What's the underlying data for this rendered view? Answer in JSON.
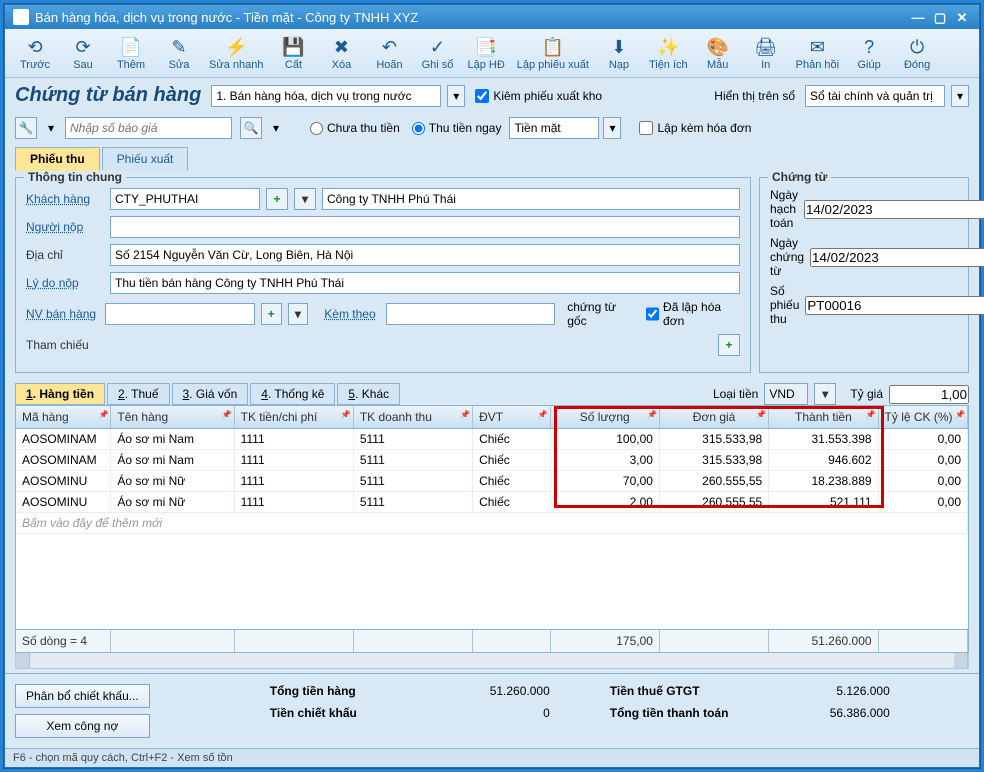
{
  "title": "Bán hàng hóa, dịch vụ trong nước - Tiền mặt - Công ty TNHH XYZ",
  "toolbar": [
    {
      "icon": "⟲",
      "label": "Trước"
    },
    {
      "icon": "⟳",
      "label": "Sau"
    },
    {
      "icon": "📄",
      "label": "Thêm"
    },
    {
      "icon": "✎",
      "label": "Sửa"
    },
    {
      "icon": "⚡",
      "label": "Sửa nhanh"
    },
    {
      "icon": "💾",
      "label": "Cất"
    },
    {
      "icon": "✖",
      "label": "Xóa"
    },
    {
      "icon": "↶",
      "label": "Hoãn"
    },
    {
      "icon": "✓",
      "label": "Ghi sổ"
    },
    {
      "icon": "📑",
      "label": "Lập HĐ"
    },
    {
      "icon": "📋",
      "label": "Lập phiếu xuất"
    },
    {
      "icon": "⬇",
      "label": "Nạp"
    },
    {
      "icon": "✨",
      "label": "Tiện ích"
    },
    {
      "icon": "🎨",
      "label": "Mẫu"
    },
    {
      "icon": "🖨",
      "label": "In"
    },
    {
      "icon": "✉",
      "label": "Phản hồi"
    },
    {
      "icon": "?",
      "label": "Giúp"
    },
    {
      "icon": "⏻",
      "label": "Đóng"
    }
  ],
  "heading": "Chứng từ bán hàng",
  "doc_type": "1. Bán hàng hóa, dịch vụ trong nước",
  "chk_kiemphieu": "Kiêm phiếu xuất kho",
  "display_on_book_lbl": "Hiển thị trên sổ",
  "display_on_book": "Sổ tài chính và quản trị",
  "search_placeholder": "Nhập số báo giá",
  "radio_chua": "Chưa thu tiền",
  "radio_ngay": "Thu tiền ngay",
  "pay_method": "Tiền mặt",
  "chk_lapkem": "Lập kèm hóa đơn",
  "tab_phieuthu": "Phiếu thu",
  "tab_phieuxuat": "Phiếu xuất",
  "panel_general": "Thông tin chung",
  "panel_doc": "Chứng từ",
  "lbl_khachhang": "Khách hàng",
  "val_khachhang_code": "CTY_PHUTHAI",
  "val_khachhang_name": "Công ty TNHH Phú Thái",
  "lbl_nguoinop": "Người nộp",
  "lbl_diachi": "Địa chỉ",
  "val_diachi": "Số 2154 Nguyễn Văn Cừ, Long Biên, Hà Nội",
  "lbl_lydo": "Lý do nộp",
  "val_lydo": "Thu tiền bán hàng Công ty TNHH Phú Thái",
  "lbl_nvbanhang": "NV bán hàng",
  "lbl_kemtheo": "Kèm theo",
  "txt_chungtugoc": "chứng từ gốc",
  "chk_dalap": "Đã lập hóa đơn",
  "lbl_thamchieu": "Tham chiếu",
  "lbl_ngayhachtoan": "Ngày hạch toán",
  "val_ngayhachtoan": "14/02/2023",
  "lbl_ngaychungtu": "Ngày chứng từ",
  "val_ngaychungtu": "14/02/2023",
  "lbl_sophieuthu": "Số phiếu thu",
  "val_sophieuthu": "PT00016",
  "subtabs": [
    "1. Hàng tiền",
    "2. Thuế",
    "3. Giá vốn",
    "4. Thống kê",
    "5. Khác"
  ],
  "lbl_loaitien": "Loại tiền",
  "val_loaitien": "VND",
  "lbl_tygia": "Tỷ giá",
  "val_tygia": "1,00",
  "grid_headers": [
    "Mã hàng",
    "Tên hàng",
    "TK tiền/chi phí",
    "TK doanh thu",
    "ĐVT",
    "Số lượng",
    "Đơn giá",
    "Thành tiền",
    "Tỷ lệ CK (%)"
  ],
  "grid_rows": [
    {
      "ma": "AOSOMINAM",
      "ten": "Áo sơ mi Nam",
      "tk1": "1111",
      "tk2": "5111",
      "dvt": "Chiếc",
      "sl": "100,00",
      "dg": "315.533,98",
      "tt": "31.553.398",
      "ck": "0,00"
    },
    {
      "ma": "AOSOMINAM",
      "ten": "Áo sơ mi Nam",
      "tk1": "1111",
      "tk2": "5111",
      "dvt": "Chiếc",
      "sl": "3,00",
      "dg": "315.533,98",
      "tt": "946.602",
      "ck": "0,00"
    },
    {
      "ma": "AOSOMINU",
      "ten": "Áo sơ mi Nữ",
      "tk1": "1111",
      "tk2": "5111",
      "dvt": "Chiếc",
      "sl": "70,00",
      "dg": "260.555,55",
      "tt": "18.238.889",
      "ck": "0,00"
    },
    {
      "ma": "AOSOMINU",
      "ten": "Áo sơ mi Nữ",
      "tk1": "1111",
      "tk2": "5111",
      "dvt": "Chiếc",
      "sl": "2,00",
      "dg": "260.555,55",
      "tt": "521.111",
      "ck": "0,00"
    }
  ],
  "grid_placeholder": "Bấm vào đây để thêm mới",
  "footer_rowcount": "Số dòng = 4",
  "footer_totals": {
    "sl": "175,00",
    "tt": "51.260.000"
  },
  "btn_phanbo": "Phân bổ chiết khấu...",
  "btn_xem": "Xem công nợ",
  "sum": {
    "tongtienhang_lbl": "Tổng tiền hàng",
    "tongtienhang": "51.260.000",
    "tienchietkhau_lbl": "Tiền chiết khấu",
    "tienchietkhau": "0",
    "tienthue_lbl": "Tiền thuế GTGT",
    "tienthue": "5.126.000",
    "tongthanhtoan_lbl": "Tổng tiền thanh toán",
    "tongthanhtoan": "56.386.000"
  },
  "statusbar": "F6 - chọn mã quy cách, Ctrl+F2 - Xem số tồn"
}
